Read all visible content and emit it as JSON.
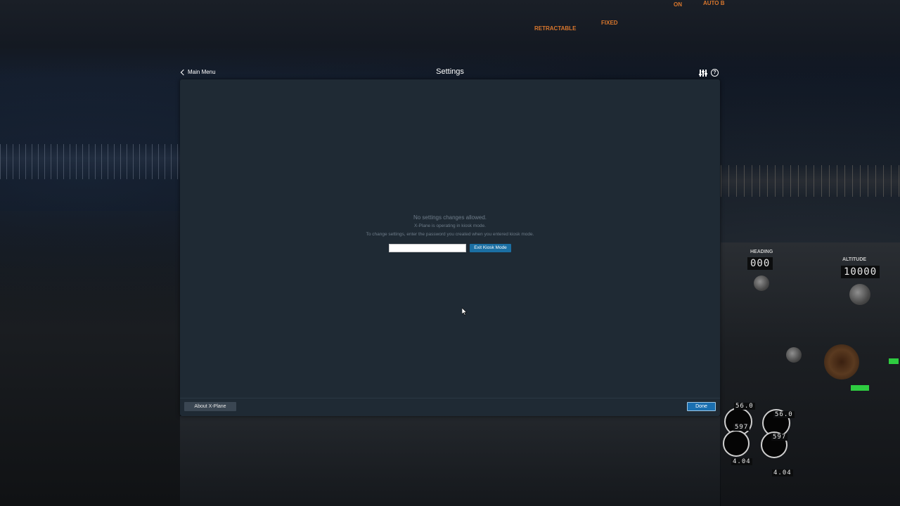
{
  "header": {
    "back_label": "Main Menu",
    "title": "Settings",
    "icons": [
      "sliders-icon",
      "help-icon"
    ]
  },
  "kiosk": {
    "title": "No settings changes allowed.",
    "line1": "X-Plane is operating in kiosk mode.",
    "line2": "To change settings, enter the password you created when you entered kiosk mode.",
    "password_value": "",
    "exit_button_label": "Exit Kiosk Mode"
  },
  "footer": {
    "about_label": "About X-Plane",
    "done_label": "Done"
  },
  "background": {
    "cockpit_labels": [
      "HEADING",
      "ALTITUDE",
      "RETRACTABLE",
      "FIXED",
      "ON",
      "AUTO B"
    ],
    "heading_value": "000",
    "altitude_value": "10000",
    "speed_value": "56.0",
    "engine_values": [
      "597",
      "597",
      "4.04",
      "4.04"
    ]
  },
  "colors": {
    "window_bg": "#1f2a34",
    "accent_blue": "#1b6fa3",
    "muted_text": "#6e7c89"
  }
}
